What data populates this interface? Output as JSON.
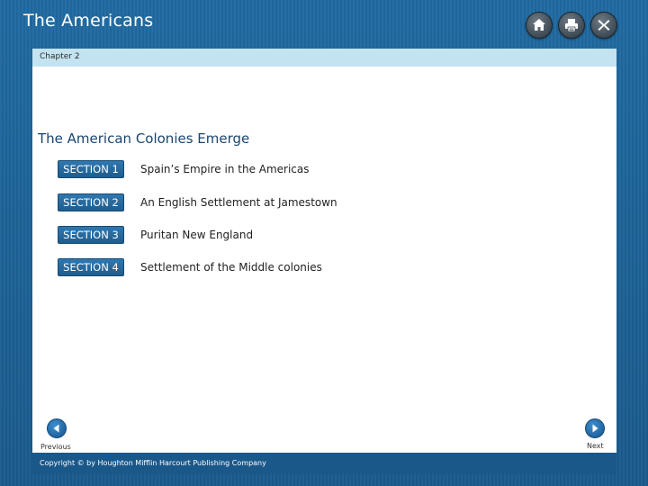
{
  "header": {
    "title": "The Americans",
    "buttons": [
      {
        "name": "home",
        "icon": "home-icon"
      },
      {
        "name": "print",
        "icon": "print-icon"
      },
      {
        "name": "close",
        "icon": "close-icon"
      }
    ]
  },
  "chapter": {
    "label": "Chapter 2"
  },
  "main": {
    "title": "The American Colonies Emerge",
    "sections": [
      {
        "button": "SECTION 1",
        "text": "Spain’s Empire in the Americas"
      },
      {
        "button": "SECTION 2",
        "text": "An English Settlement at Jamestown"
      },
      {
        "button": "SECTION 3",
        "text": "Puritan New England"
      },
      {
        "button": "SECTION 4",
        "text": "Settlement of the Middle colonies"
      }
    ]
  },
  "nav": {
    "previous_label": "Previous",
    "next_label": "Next",
    "previous_icon": "arrow-left-icon",
    "next_icon": "arrow-right-icon"
  },
  "footer": {
    "copyright": "Copyright © by Houghton Mifflin Harcourt Publishing Company"
  },
  "colors": {
    "frame": "#1d5f92",
    "chapter_bar": "#c3e3f0",
    "section_button": "#2a6fa6",
    "title_text": "#1a4570"
  }
}
